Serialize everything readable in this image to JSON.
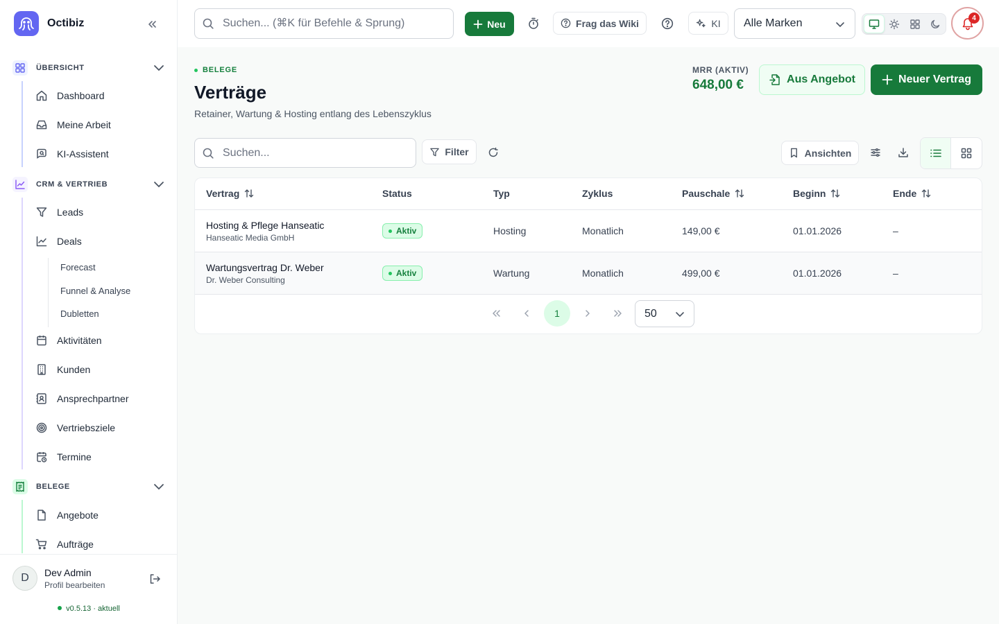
{
  "app": {
    "name": "Octibiz",
    "version": "v0.5.13",
    "version_status": "· aktuell"
  },
  "sidebar": {
    "sections": [
      {
        "label": "ÜBERSICHT",
        "icon": "grid-icon",
        "items": [
          "Dashboard",
          "Meine Arbeit",
          "KI-Assistent"
        ]
      },
      {
        "label": "CRM & VERTRIEB",
        "icon": "chart-line-icon",
        "items": [
          "Leads",
          "Deals",
          "Aktivitäten",
          "Kunden",
          "Ansprechpartner",
          "Vertriebsziele",
          "Termine"
        ],
        "sub_items": [
          "Forecast",
          "Funnel & Analyse",
          "Dubletten"
        ]
      },
      {
        "label": "BELEGE",
        "icon": "receipt-icon",
        "items": [
          "Angebote",
          "Aufträge"
        ]
      }
    ]
  },
  "user": {
    "initial": "D",
    "name": "Dev Admin",
    "profile_label": "Profil bearbeiten"
  },
  "topbar": {
    "search_placeholder": "Suchen... (⌘K für Befehle & Sprung)",
    "new_label": "Neu",
    "wiki_label": "Frag das Wiki",
    "ai_label": "KI",
    "brand_select": "Alle Marken",
    "notifications": "4",
    "theme_selected": "system"
  },
  "page": {
    "eyebrow": "BELEGE",
    "title": "Verträge",
    "subtitle": "Retainer, Wartung & Hosting entlang des Lebenszyklus",
    "mrr_label": "MRR (AKTIV)",
    "mrr_value": "648,00 €",
    "from_offer_label": "Aus Angebot",
    "new_contract_label": "Neuer Vertrag"
  },
  "toolbar": {
    "search_placeholder": "Suchen...",
    "filter_label": "Filter",
    "views_label": "Ansichten",
    "view_mode": "list"
  },
  "table": {
    "columns": [
      "Vertrag",
      "Status",
      "Typ",
      "Zyklus",
      "Pauschale",
      "Beginn",
      "Ende"
    ],
    "rows": [
      {
        "name": "Hosting & Pflege Hanseatic",
        "client": "Hanseatic Media GmbH",
        "status": "Aktiv",
        "type": "Hosting",
        "cycle": "Monatlich",
        "fee": "149,00 €",
        "start": "01.01.2026",
        "end": "–"
      },
      {
        "name": "Wartungsvertrag Dr. Weber",
        "client": "Dr. Weber Consulting",
        "status": "Aktiv",
        "type": "Wartung",
        "cycle": "Monatlich",
        "fee": "499,00 €",
        "start": "01.01.2026",
        "end": "–"
      }
    ]
  },
  "pagination": {
    "current_page": "1",
    "page_size": "50"
  },
  "colors": {
    "accent": "#177a3b",
    "status_active": "#15803d",
    "brand": "#6366f1",
    "notification": "#dc2626"
  }
}
